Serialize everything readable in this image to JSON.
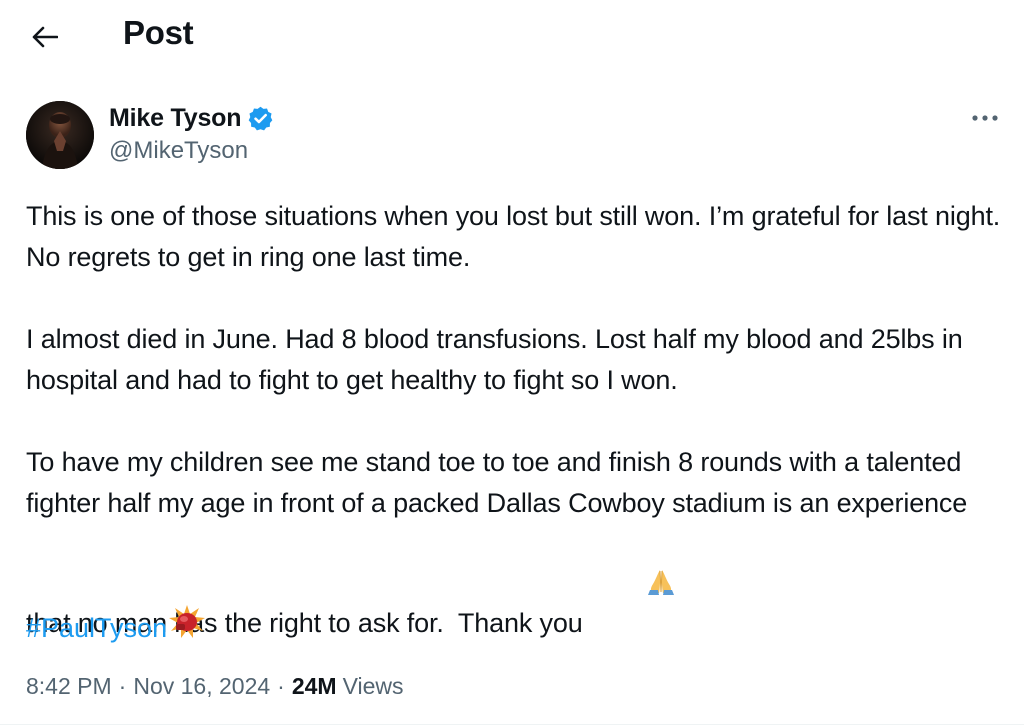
{
  "header": {
    "back_icon": "arrow-left-icon",
    "title": "Post"
  },
  "author": {
    "name": "Mike Tyson",
    "handle": "@MikeTyson",
    "verified_icon": "verified-badge-icon",
    "verified_color": "#1d9bf0",
    "more_icon": "more-horizontal-icon"
  },
  "post": {
    "paragraphs": [
      "This is one of those situations when you lost but still won. I’m grateful for last night.  No regrets to get in ring one last time.",
      "I almost died in June. Had 8 blood transfusions. Lost half my blood and 25lbs in hospital and had to fight to get healthy to fight so I won.",
      "To have my children see me stand toe to toe and finish 8 rounds with a talented fighter half my age in front of a packed Dallas Cowboy stadium is an experience that no man has the right to ask for.  Thank you"
    ],
    "thank_you_emoji": "folded-hands-emoji",
    "hashtag": "#PaulTyson",
    "hashtag_emoji": "boxing-glove-emoji",
    "hashtag_color": "#1d9bf0"
  },
  "meta": {
    "time": "8:42 PM",
    "date": "Nov 16, 2024",
    "separator": "·",
    "views_count": "24M",
    "views_label": "Views"
  }
}
